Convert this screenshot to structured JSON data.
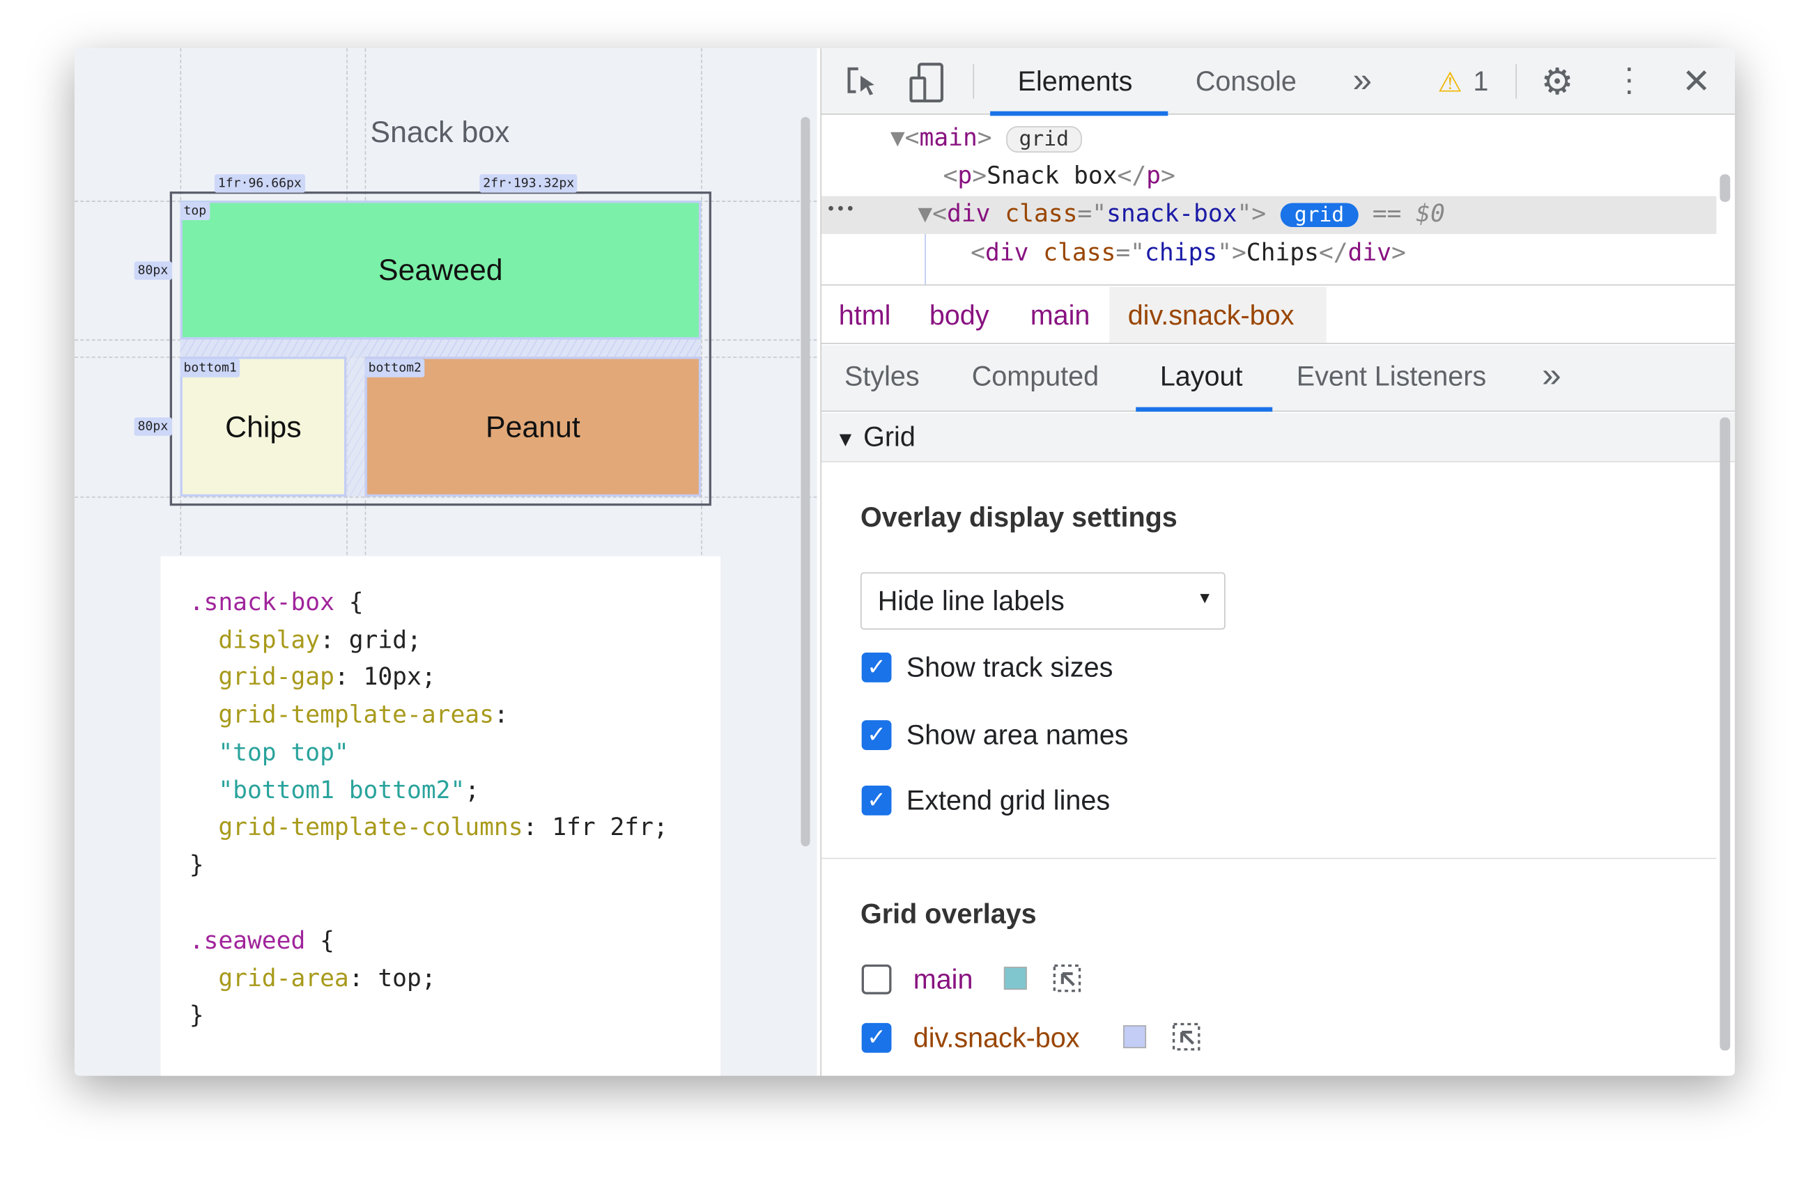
{
  "page": {
    "heading": "Snack box",
    "items": [
      {
        "label": "Seaweed",
        "area": "top",
        "color": "#7bf0a8"
      },
      {
        "label": "Chips",
        "area": "bottom1",
        "color": "#f5f6dc"
      },
      {
        "label": "Peanut",
        "area": "bottom2",
        "color": "#e2a878"
      }
    ],
    "track_labels": {
      "col1": "1fr·96.66px",
      "col2": "2fr·193.32px",
      "row1": "80px",
      "row2": "80px"
    }
  },
  "code": [
    [
      {
        "c": "sel",
        "t": ".snack-box"
      },
      {
        "c": "",
        "t": " {"
      }
    ],
    [
      {
        "c": "prop",
        "t": "  display"
      },
      {
        "c": "",
        "t": ": grid;"
      }
    ],
    [
      {
        "c": "prop",
        "t": "  grid-gap"
      },
      {
        "c": "",
        "t": ": 10px;"
      }
    ],
    [
      {
        "c": "prop",
        "t": "  grid-template-areas"
      },
      {
        "c": "",
        "t": ":"
      }
    ],
    [
      {
        "c": "str",
        "t": "  \"top top\""
      }
    ],
    [
      {
        "c": "str",
        "t": "  \"bottom1 bottom2\""
      },
      {
        "c": "",
        "t": ";"
      }
    ],
    [
      {
        "c": "prop",
        "t": "  grid-template-columns"
      },
      {
        "c": "",
        "t": ": 1fr 2fr;"
      }
    ],
    [
      {
        "c": "",
        "t": "}"
      }
    ],
    [],
    [
      {
        "c": "sel",
        "t": ".seaweed"
      },
      {
        "c": "",
        "t": " {"
      }
    ],
    [
      {
        "c": "prop",
        "t": "  grid-area"
      },
      {
        "c": "",
        "t": ": top;"
      }
    ],
    [
      {
        "c": "",
        "t": "}"
      }
    ]
  ],
  "devtools": {
    "tabs": [
      "Elements",
      "Console"
    ],
    "active_tab": "Elements",
    "more": "»",
    "warnings": "1",
    "dom": {
      "main_tag": "main",
      "main_badge": "grid",
      "p_open": "p",
      "p_text": "Snack box",
      "div_class": "snack-box",
      "div_badge": "grid",
      "selected_marker": "== $0",
      "child_class": "chips",
      "child_text": "Chips",
      "ellipsis": "•••"
    },
    "breadcrumbs": [
      "html",
      "body",
      "main",
      "div.snack-box"
    ],
    "subtabs": [
      "Styles",
      "Computed",
      "Layout",
      "Event Listeners"
    ],
    "active_subtab": "Layout",
    "section": "Grid",
    "overlay_title": "Overlay display settings",
    "select_value": "Hide line labels",
    "checks": [
      {
        "label": "Show track sizes",
        "checked": true
      },
      {
        "label": "Show area names",
        "checked": true
      },
      {
        "label": "Extend grid lines",
        "checked": true
      }
    ],
    "overlays_title": "Grid overlays",
    "overlays": [
      {
        "label": "main",
        "checked": false,
        "color": "#7fc6cf"
      },
      {
        "label": "div.snack-box",
        "checked": true,
        "color": "#c3cdf6"
      }
    ]
  }
}
